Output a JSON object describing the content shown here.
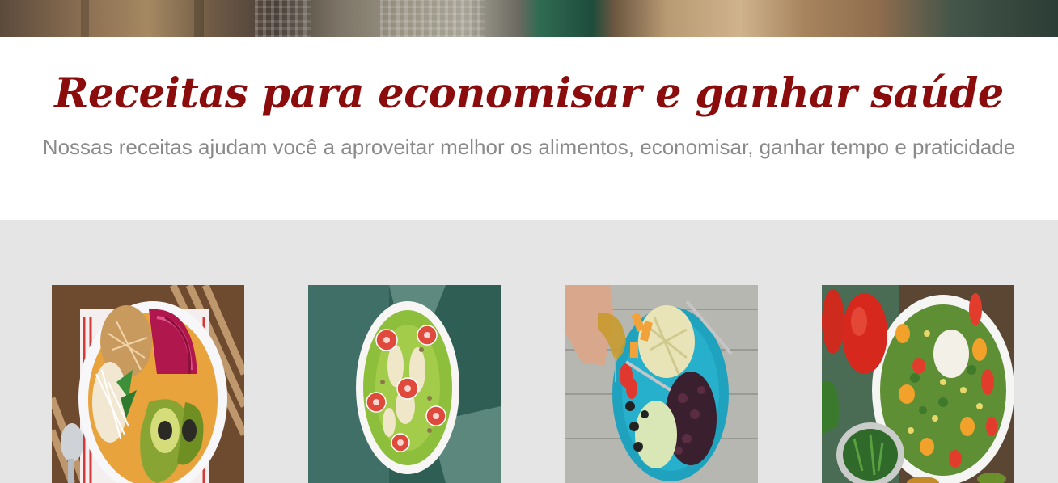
{
  "header": {
    "title": "Receitas para economisar e ganhar saúde",
    "subtitle": "Nossas receitas ajudam você a aproveitar melhor os alimentos, economisar, ganhar tempo e praticidade"
  },
  "gallery": {
    "items": [
      {
        "image": "acai-bowl-photo"
      },
      {
        "image": "kiwi-strawberry-bowl-photo"
      },
      {
        "image": "salad-olive-oil-photo"
      },
      {
        "image": "tomato-burrata-salad-photo"
      }
    ]
  },
  "colors": {
    "title": "#8b0c0c",
    "subtitle": "#8a8a8a",
    "gallery_background": "#e5e5e5"
  }
}
